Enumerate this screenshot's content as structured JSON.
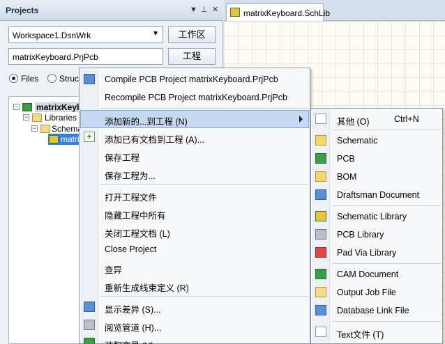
{
  "projects_panel": {
    "title": "Projects",
    "workspace_combo": "Workspace1.DsnWrk",
    "workspace_button": "工作区",
    "project_field": "matrixKeyboard.PrjPcb",
    "project_button": "工程",
    "radio_files": "Files",
    "radio_structure": "Struc",
    "tree": {
      "project": "matrixKeybo",
      "libraries": "Libraries",
      "schematic": "Schema",
      "library_item": "matri"
    }
  },
  "document_tab": "matrixKeyboard.SchLib",
  "context_menu": {
    "items": [
      "Compile PCB Project matrixKeyboard.PrjPcb",
      "Recompile PCB Project matrixKeyboard.PrjPcb",
      "添加新的...到工程 (N)",
      "添加已有文档到工程 (A)...",
      "保存工程",
      "保存工程为...",
      "打开工程文件",
      "隐藏工程中所有",
      "关闭工程文档 (L)",
      "Close Project",
      "查异",
      "重新生成线束定义 (R)",
      "显示差异 (S)...",
      "阅览管道 (H)...",
      "装配变量 (V)"
    ]
  },
  "submenu": {
    "items": [
      {
        "label": "其他 (O)",
        "shortcut": "Ctrl+N",
        "icon": "blank-document-icon"
      },
      {
        "label": "Schematic",
        "icon": "schematic-icon"
      },
      {
        "label": "PCB",
        "icon": "pcb-icon"
      },
      {
        "label": "BOM",
        "icon": "bom-icon"
      },
      {
        "label": "Draftsman Document",
        "icon": "draftsman-icon"
      },
      {
        "label": "Schematic Library",
        "icon": "schematic-library-icon"
      },
      {
        "label": "PCB Library",
        "icon": "pcb-library-icon"
      },
      {
        "label": "Pad Via Library",
        "icon": "pad-via-library-icon"
      },
      {
        "label": "CAM Document",
        "icon": "cam-document-icon"
      },
      {
        "label": "Output Job File",
        "icon": "output-job-icon"
      },
      {
        "label": "Database Link File",
        "icon": "database-link-icon"
      },
      {
        "label": "Text文件 (T)",
        "icon": "text-file-icon"
      }
    ]
  }
}
